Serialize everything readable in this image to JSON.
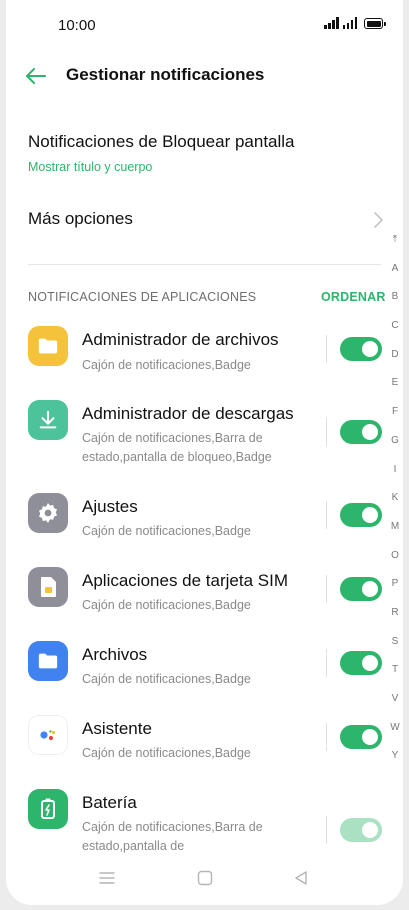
{
  "status": {
    "time": "10:00"
  },
  "header": {
    "title": "Gestionar notificaciones"
  },
  "lock_screen": {
    "title": "Notificaciones de Bloquear pantalla",
    "value": "Mostrar título y cuerpo"
  },
  "more_options": {
    "label": "Más opciones"
  },
  "section": {
    "title": "NOTIFICACIONES DE APLICACIONES",
    "order_label": "ORDENAR"
  },
  "apps": [
    {
      "name": "Administrador de archivos",
      "desc": "Cajón de notificaciones,Badge",
      "icon": "folder-icon",
      "color": "#f5c33b",
      "enabled": true
    },
    {
      "name": "Administrador de descargas",
      "desc": "Cajón de notificaciones,Barra de estado,pantalla de bloqueo,Badge",
      "icon": "download-icon",
      "color": "#4dc39b",
      "enabled": true
    },
    {
      "name": "Ajustes",
      "desc": "Cajón de notificaciones,Badge",
      "icon": "gear-icon",
      "color": "#8f8f99",
      "enabled": true
    },
    {
      "name": "Aplicaciones de tarjeta SIM",
      "desc": "Cajón de notificaciones,Badge",
      "icon": "sim-card-icon",
      "color": "#8f8f99",
      "enabled": true
    },
    {
      "name": "Archivos",
      "desc": "Cajón de notificaciones,Badge",
      "icon": "files-folder-icon",
      "color": "#3f82f0",
      "enabled": true
    },
    {
      "name": "Asistente",
      "desc": "Cajón de notificaciones,Badge",
      "icon": "assistant-icon",
      "color": "#ffffff",
      "enabled": true
    },
    {
      "name": "Batería",
      "desc": "Cajón de notificaciones,Barra de estado,pantalla de",
      "icon": "battery-icon",
      "color": "#2db56c",
      "enabled": true
    }
  ],
  "alphabet": [
    "A",
    "B",
    "C",
    "D",
    "E",
    "F",
    "G",
    "I",
    "K",
    "M",
    "O",
    "P",
    "R",
    "S",
    "T",
    "V",
    "W",
    "Y"
  ],
  "colors": {
    "accent": "#2db56c"
  }
}
